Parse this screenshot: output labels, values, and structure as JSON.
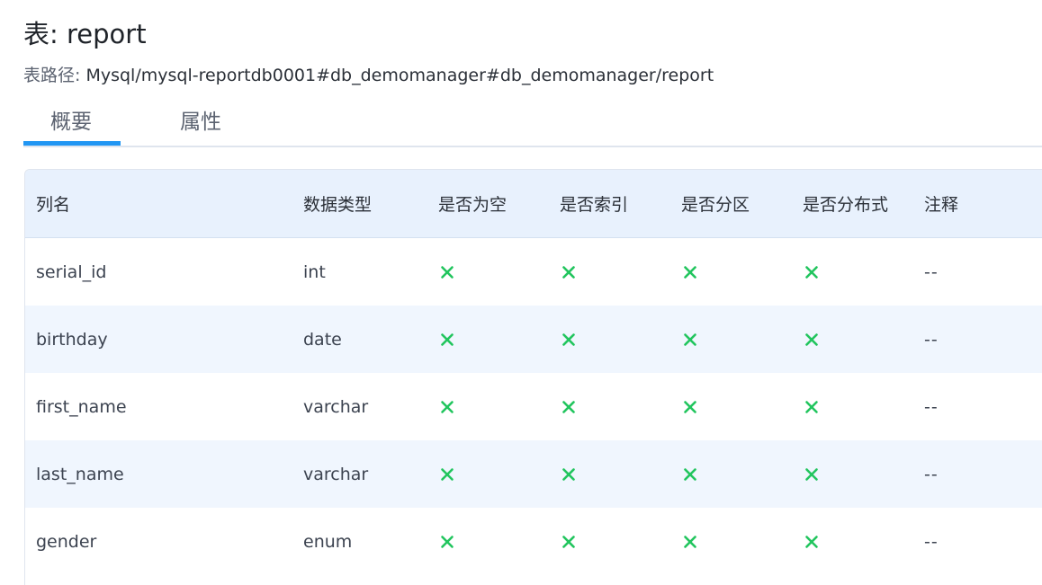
{
  "header": {
    "title": "表: report",
    "path_label": "表路径:",
    "path_value": "Mysql/mysql-reportdb0001#db_demomanager#db_demomanager/report"
  },
  "tabs": [
    {
      "label": "概要",
      "active": true
    },
    {
      "label": "属性",
      "active": false
    }
  ],
  "colors": {
    "accent": "#2196f3",
    "cross": "#22c55e",
    "header_bg": "#e8f1fd",
    "alt_row_bg": "#f0f6fe"
  },
  "table": {
    "columns": [
      "列名",
      "数据类型",
      "是否为空",
      "是否索引",
      "是否分区",
      "是否分布式",
      "注释"
    ],
    "rows": [
      {
        "name": "serial_id",
        "type": "int",
        "nullable": "cross-icon",
        "indexed": "cross-icon",
        "partitioned": "cross-icon",
        "distributed": "cross-icon",
        "comment": "--"
      },
      {
        "name": "birthday",
        "type": "date",
        "nullable": "cross-icon",
        "indexed": "cross-icon",
        "partitioned": "cross-icon",
        "distributed": "cross-icon",
        "comment": "--"
      },
      {
        "name": "first_name",
        "type": "varchar",
        "nullable": "cross-icon",
        "indexed": "cross-icon",
        "partitioned": "cross-icon",
        "distributed": "cross-icon",
        "comment": "--"
      },
      {
        "name": "last_name",
        "type": "varchar",
        "nullable": "cross-icon",
        "indexed": "cross-icon",
        "partitioned": "cross-icon",
        "distributed": "cross-icon",
        "comment": "--"
      },
      {
        "name": "gender",
        "type": "enum",
        "nullable": "cross-icon",
        "indexed": "cross-icon",
        "partitioned": "cross-icon",
        "distributed": "cross-icon",
        "comment": "--"
      }
    ]
  }
}
